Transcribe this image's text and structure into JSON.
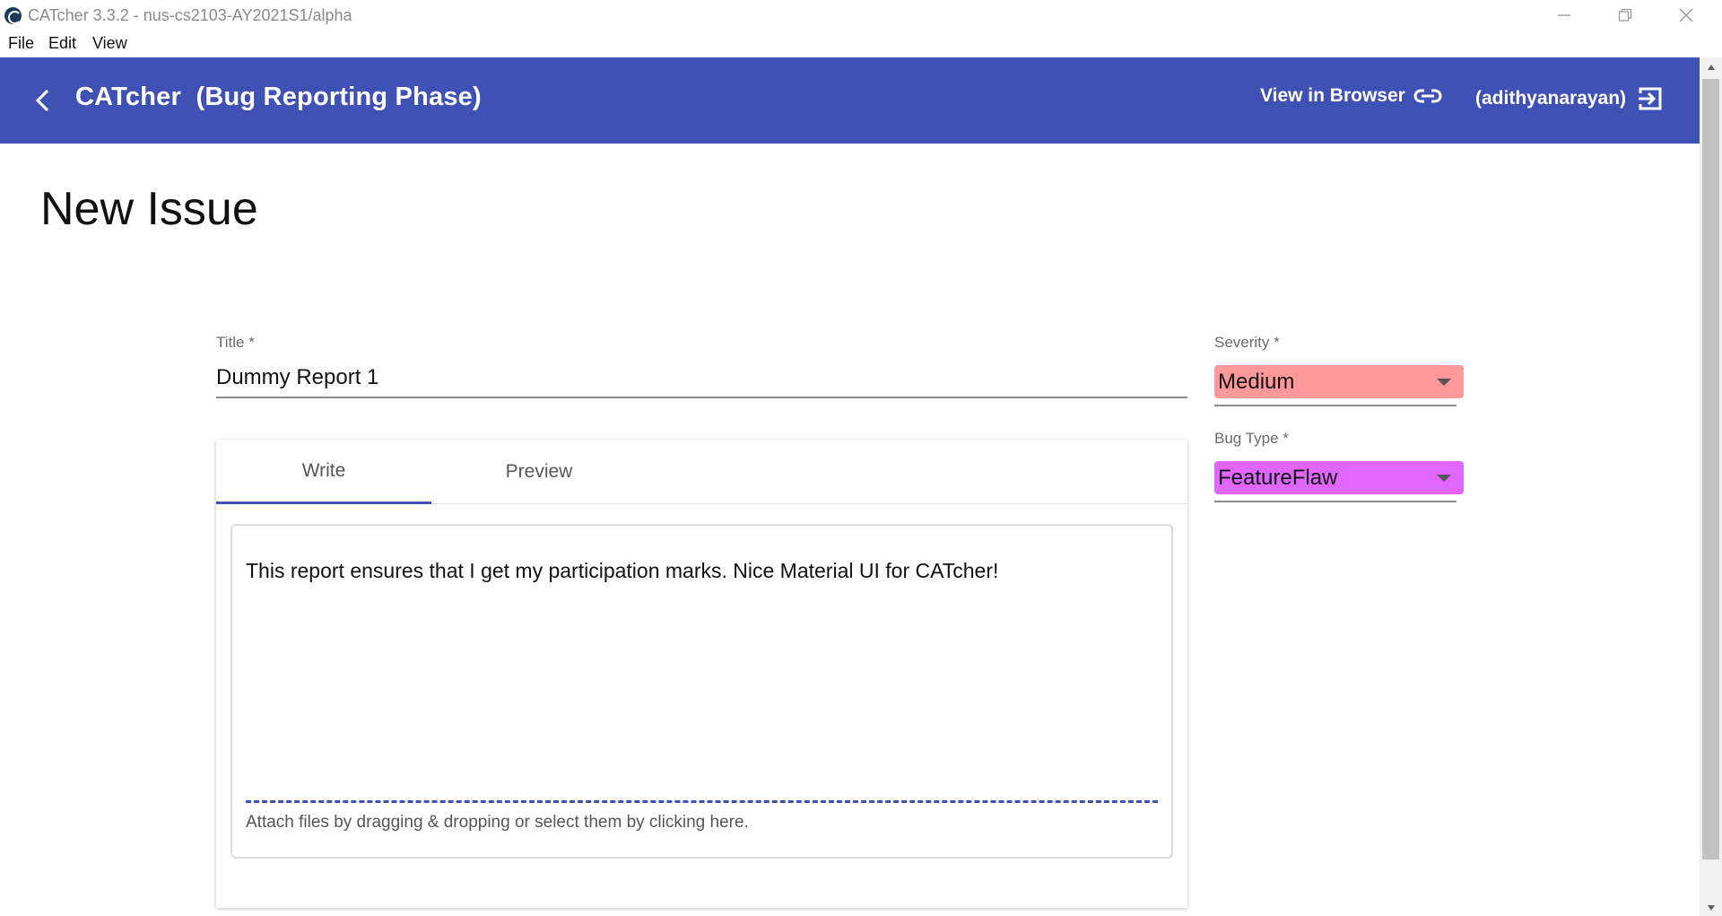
{
  "window": {
    "title": "CATcher 3.3.2 - nus-cs2103-AY2021S1/alpha",
    "menu": [
      "File",
      "Edit",
      "View"
    ]
  },
  "toolbar": {
    "app_title": "CATcher  (Bug Reporting Phase)",
    "view_in_browser": "View in Browser",
    "user": "(adithyanarayan)"
  },
  "page": {
    "title": "New Issue"
  },
  "form": {
    "title_label": "Title *",
    "title_value": "Dummy Report 1",
    "tabs": [
      "Write",
      "Preview"
    ],
    "description": "This report ensures that I get my participation marks. Nice Material UI for CATcher!",
    "attach_hint": "Attach files by dragging & dropping or select them by clicking here.",
    "severity_label": "Severity *",
    "severity_value": "Medium",
    "bug_type_label": "Bug Type *",
    "bug_type_value": "FeatureFlaw"
  },
  "colors": {
    "primary": "#3f51b5",
    "severity_medium": "#ff9999",
    "bug_type_featureflaw": "#e066ff"
  }
}
